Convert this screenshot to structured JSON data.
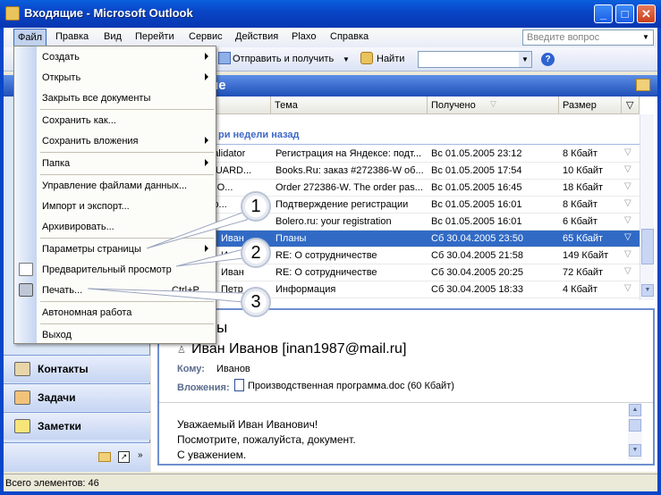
{
  "window": {
    "title": "Входящие - Microsoft Outlook",
    "minimize": "_",
    "maximize": "□",
    "close": "✕"
  },
  "menubar": {
    "items": [
      "Файл",
      "Правка",
      "Вид",
      "Перейти",
      "Сервис",
      "Действия",
      "Plaxo",
      "Справка"
    ],
    "ask_placeholder": "Введите вопрос"
  },
  "toolbar": {
    "send_receive": "Отправить и получить",
    "find": "Найти"
  },
  "file_menu": {
    "items": [
      {
        "label": "Создать",
        "submenu": true
      },
      {
        "label": "Открыть",
        "submenu": true
      },
      {
        "label": "Закрыть все документы"
      },
      {
        "label": "Сохранить как..."
      },
      {
        "label": "Сохранить вложения",
        "submenu": true
      },
      {
        "label": "Папка",
        "submenu": true
      },
      {
        "label": "Управление файлами данных..."
      },
      {
        "label": "Импорт и экспорт..."
      },
      {
        "label": "Архивировать..."
      },
      {
        "label": "Параметры страницы",
        "submenu": true
      },
      {
        "label": "Предварительный просмотр"
      },
      {
        "label": "Печать...",
        "shortcut": "Ctrl+P"
      },
      {
        "label": "Автономная работа"
      },
      {
        "label": "Выход"
      }
    ]
  },
  "folder": {
    "title_fragment": "ие"
  },
  "columns": {
    "subject": "Тема",
    "received": "Получено",
    "size": "Размер"
  },
  "group_label": "ри недели назад",
  "messages": [
    {
      "from": "ex Validator",
      "subject": "Регистрация на Яндексе: подт...",
      "received": "Вс 01.05.2005 23:12",
      "size": "8 Кбайт"
    },
    {
      "from": "ERGUARD...",
      "subject": "Books.Ru: заказ #272386-W об...",
      "received": "Вс 01.05.2005 17:54",
      "size": "10 Кбайт"
    },
    {
      "from": "s.Ru O...",
      "subject": "Order 272386-W. The order pas...",
      "received": "Вс 01.05.2005 16:45",
      "size": "18 Кбайт"
    },
    {
      "from": "ер ер...",
      "subject": "Подтверждение регистрации",
      "received": "Вс 01.05.2005 16:01",
      "size": "8 Кбайт"
    },
    {
      "from": "...",
      "subject": "Bolero.ru: your registration",
      "received": "Вс 01.05.2005 16:01",
      "size": "6 Кбайт"
    },
    {
      "from": "Иван",
      "subject": "Планы",
      "received": "Сб 30.04.2005 23:50",
      "size": "65 Кбайт"
    },
    {
      "from": "Иван",
      "subject": "RE: О сотрудничестве",
      "received": "Сб 30.04.2005 21:58",
      "size": "149 Кбайт"
    },
    {
      "from": "Иван",
      "subject": "RE: О сотрудничестве",
      "received": "Сб 30.04.2005 20:25",
      "size": "72 Кбайт"
    },
    {
      "from": "Петр",
      "subject": "Информация",
      "received": "Сб 30.04.2005 18:33",
      "size": "4 Кбайт"
    }
  ],
  "nav": {
    "contacts": "Контакты",
    "tasks": "Задачи",
    "notes": "Заметки"
  },
  "reading": {
    "subject_fragment": "ы",
    "sender": "Иван Иванов [inan1987@mail.ru]",
    "to_label": "Кому:",
    "to_value": "Иванов",
    "attach_label": "Вложения:",
    "attachment": "Производственная программа.doc (60 Кбайт)",
    "body": [
      "Уважаемый Иван Иванович!",
      "Посмотрите, пожалуйста, документ.",
      "С уважением."
    ]
  },
  "status": {
    "text": "Всего элементов: 46"
  },
  "callouts": [
    "1",
    "2",
    "3"
  ],
  "colors": {
    "titlebar": "#0946c8",
    "selection": "#316ac5",
    "group_text": "#3e68c8"
  }
}
